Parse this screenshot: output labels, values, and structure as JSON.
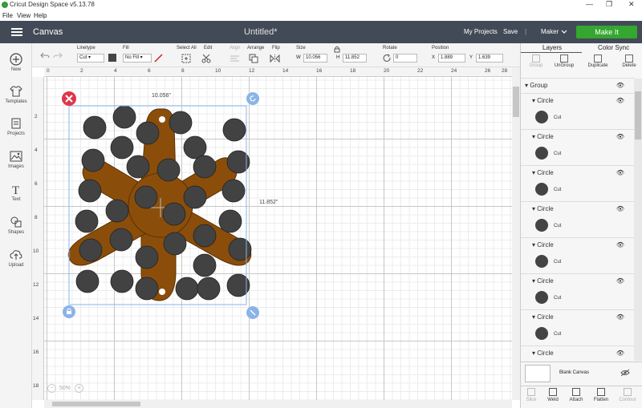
{
  "window": {
    "title": "Cricut Design Space  v5.13.78",
    "controls": [
      "—",
      "❐",
      "✕"
    ]
  },
  "menu": [
    "File",
    "View",
    "Help"
  ],
  "header": {
    "app_section": "Canvas",
    "doc_title": "Untitled*",
    "my_projects": "My Projects",
    "save": "Save",
    "divider": "|",
    "machine": "Maker",
    "make_it": "Make It",
    "brand_green": "#35a62f",
    "bar_color": "#434a57"
  },
  "sidebar": [
    {
      "label": "New",
      "icon": "plus-icon"
    },
    {
      "label": "Templates",
      "icon": "shirt-icon"
    },
    {
      "label": "Projects",
      "icon": "projects-icon"
    },
    {
      "label": "Images",
      "icon": "image-icon"
    },
    {
      "label": "Text",
      "icon": "text-icon"
    },
    {
      "label": "Shapes",
      "icon": "shapes-icon"
    },
    {
      "label": "Upload",
      "icon": "upload-icon"
    }
  ],
  "toolbar": {
    "linetype_label": "Linetype",
    "linetype_value": "Cut",
    "fill_label": "Fill",
    "fill_value": "No Fill",
    "select_all": "Select All",
    "edit": "Edit",
    "align": "Align",
    "arrange": "Arrange",
    "flip": "Flip",
    "size_label": "Size",
    "w_label": "W",
    "w_value": "10.056",
    "h_label": "H",
    "h_value": "11.852",
    "rotate_label": "Rotate",
    "rotate_value": "0",
    "position_label": "Position",
    "x_label": "X",
    "x_value": "1.889",
    "y_label": "Y",
    "y_value": "1.639"
  },
  "ruler": {
    "top": [
      "0",
      "2",
      "4",
      "6",
      "8",
      "10",
      "12",
      "14",
      "16",
      "18",
      "20",
      "22",
      "24",
      "26",
      "28"
    ],
    "left": [
      "2",
      "4",
      "6",
      "8",
      "10",
      "12",
      "14",
      "16",
      "18"
    ]
  },
  "canvas": {
    "width_dim": "10.056\"",
    "height_dim": "11.852\"",
    "zoom": "50%",
    "zoom_minus": "−",
    "zoom_plus": "+",
    "shape_color": "#8b4e0a",
    "circle_color": "#424242",
    "selection_color": "#8ab4e6"
  },
  "panel": {
    "tabs": [
      "Layers",
      "Color Sync"
    ],
    "actions": [
      "Group",
      "UnGroup",
      "Duplicate",
      "Delete"
    ],
    "group_label": "Group",
    "layers": [
      {
        "name": "Circle",
        "op": "Cut"
      },
      {
        "name": "Circle",
        "op": "Cut"
      },
      {
        "name": "Circle",
        "op": "Cut"
      },
      {
        "name": "Circle",
        "op": "Cut"
      },
      {
        "name": "Circle",
        "op": "Cut"
      },
      {
        "name": "Circle",
        "op": "Cut"
      },
      {
        "name": "Circle",
        "op": "Cut"
      },
      {
        "name": "Circle",
        "op": ""
      }
    ],
    "blank_canvas": "Blank Canvas",
    "bottom_actions": [
      "Slice",
      "Weld",
      "Attach",
      "Flatten",
      "Contour"
    ]
  }
}
